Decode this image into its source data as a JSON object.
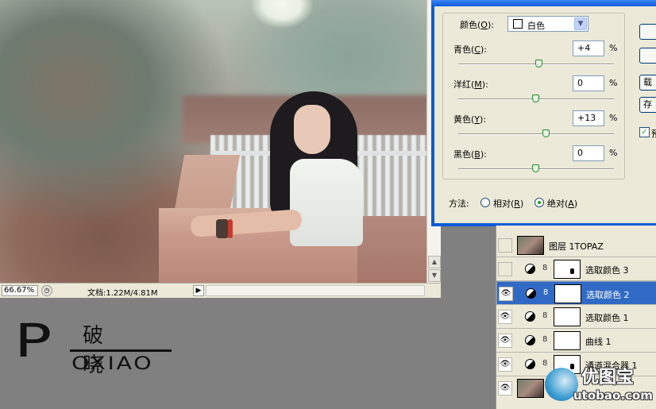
{
  "document": {
    "zoom": "66.67%",
    "doc_info": "文档:1.22M/4.81M"
  },
  "dialog": {
    "colors_label": "颜色(",
    "colors_key": "O",
    "colors_close": "):",
    "colors_value": "白色",
    "sliders": [
      {
        "label": "青色(",
        "key": "C",
        "close": "):",
        "value": "+4",
        "unit": "%",
        "level": 0.52
      },
      {
        "label": "洋红(",
        "key": "M",
        "close": "):",
        "value": "0",
        "unit": "%",
        "level": 0.5
      },
      {
        "label": "黄色(",
        "key": "Y",
        "close": "):",
        "value": "+13",
        "unit": "%",
        "level": 0.565
      },
      {
        "label": "黑色(",
        "key": "B",
        "close": "):",
        "value": "0",
        "unit": "%",
        "level": 0.5
      }
    ],
    "method_label": "方法:",
    "method_relative": "相对(",
    "method_relative_key": "R",
    "method_relative_close": ")",
    "method_absolute": "绝对(",
    "method_absolute_key": "A",
    "method_absolute_close": ")",
    "method_selected": "absolute",
    "side_buttons": [
      "载",
      "存"
    ],
    "preview_label": "预",
    "preview_checked": true
  },
  "layers": [
    {
      "name": "图层 1TOPAZ",
      "visible": false,
      "type": "image"
    },
    {
      "name": "选取颜色 3",
      "visible": false,
      "type": "adjust",
      "mask_dot": true
    },
    {
      "name": "选取颜色 2",
      "visible": true,
      "type": "adjust",
      "selected": true
    },
    {
      "name": "选取颜色 1",
      "visible": true,
      "type": "adjust"
    },
    {
      "name": "曲线 1",
      "visible": true,
      "type": "adjust"
    },
    {
      "name": "通道混合器 1",
      "visible": true,
      "type": "adjust",
      "mask_dot": true
    }
  ],
  "logo": {
    "big_letter": "P",
    "chinese": "破晓",
    "english": "OXIAO"
  },
  "watermark": {
    "chinese": "优图宝",
    "url": "utobao.com"
  },
  "colors": {
    "selection_blue": "#316ac5",
    "title_blue": "#0b5bd8",
    "panel_bg": "#ece9d8",
    "workspace_gray": "#808080"
  }
}
